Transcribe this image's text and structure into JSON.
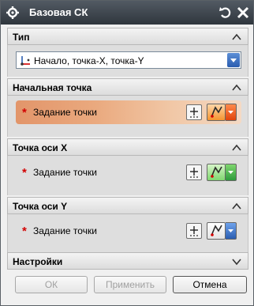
{
  "dialog": {
    "title": "Базовая СК",
    "title_icon": "gear-icon",
    "reset_icon": "reset-icon",
    "close_icon": "close-icon"
  },
  "sections": {
    "type": {
      "header": "Тип",
      "expanded": true,
      "combo_value": "Начало, точка-X, точка-Y",
      "combo_icon": "csys-origin-xy-icon"
    },
    "origin_point": {
      "header": "Начальная точка",
      "expanded": true,
      "required_mark": "*",
      "label": "Задание точки",
      "active": true,
      "snap_color": "#f5932e"
    },
    "x_axis_point": {
      "header": "Точка оси X",
      "expanded": true,
      "required_mark": "*",
      "label": "Задание точки",
      "active": false,
      "snap_color": "#3fb34a"
    },
    "y_axis_point": {
      "header": "Точка оси Y",
      "expanded": true,
      "required_mark": "*",
      "label": "Задание точки",
      "active": false,
      "snap_color": "#2f6fd0"
    },
    "settings": {
      "header": "Настройки",
      "expanded": false
    }
  },
  "buttons": {
    "ok": "ОК",
    "apply": "Применить",
    "cancel": "Отмена"
  },
  "colors": {
    "titlebar": "#3a4148",
    "active_row": "#e8a070",
    "required": "#d20000",
    "accent_blue": "#2a5db0"
  }
}
